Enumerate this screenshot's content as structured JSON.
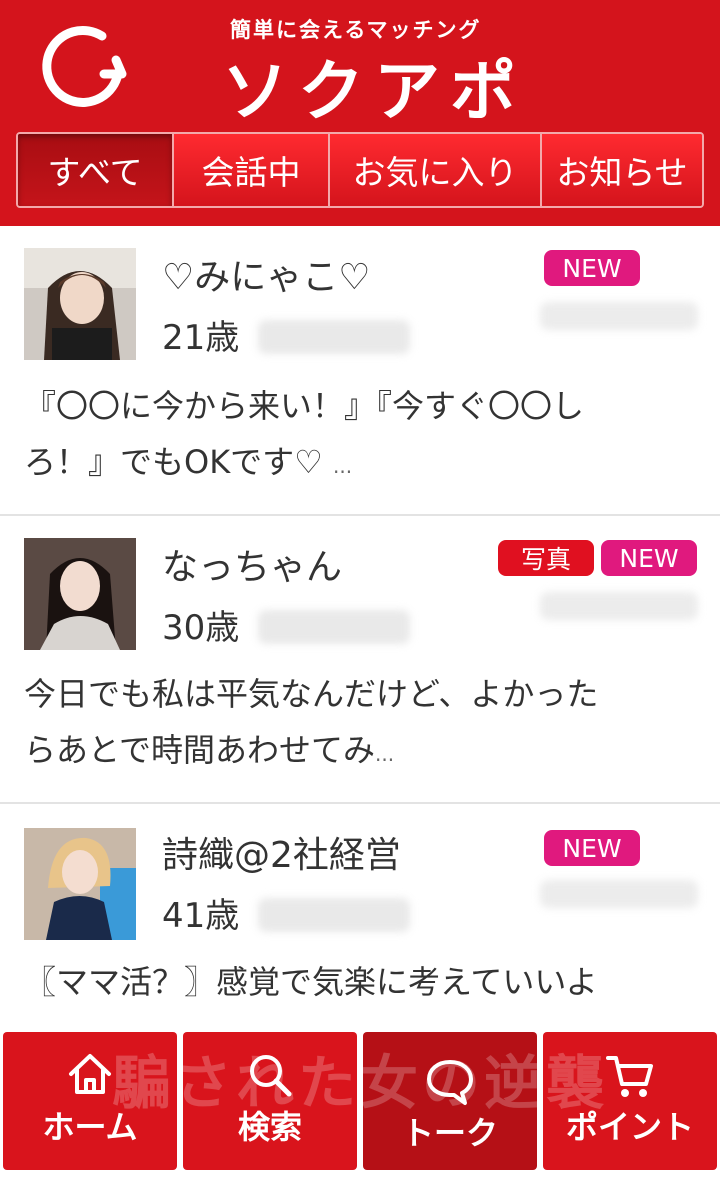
{
  "header": {
    "tagline": "簡単に会えるマッチング",
    "brand": "ソクアポ",
    "tabs": [
      {
        "label": "すべて",
        "active": true
      },
      {
        "label": "会話中",
        "active": false
      },
      {
        "label": "お気に入り",
        "active": false
      },
      {
        "label": "お知らせ",
        "active": false
      }
    ]
  },
  "messages": [
    {
      "name": "♡みにゃこ♡",
      "age": "21歳",
      "badges": [
        "NEW"
      ],
      "preview_line1": "『〇〇に今から来い！』『今すぐ〇〇し",
      "preview_line2": "ろ！』でもOKです♡",
      "ellipsis": "..."
    },
    {
      "name": "なっちゃん",
      "age": "30歳",
      "badges": [
        "写真",
        "NEW"
      ],
      "preview_line1": "今日でも私は平気なんだけど、よかった",
      "preview_line2": "らあとで時間あわせてみ",
      "ellipsis": "..."
    },
    {
      "name": "詩織@2社経営",
      "age": "41歳",
      "badges": [
        "NEW"
      ],
      "preview_line1": "〖ママ活？〗感覚で気楽に考えていいよ",
      "preview_line2": "",
      "ellipsis": ""
    }
  ],
  "bottom_nav": [
    {
      "label": "ホーム",
      "icon": "home-icon",
      "active": false
    },
    {
      "label": "検索",
      "icon": "search-icon",
      "active": false
    },
    {
      "label": "トーク",
      "icon": "chat-bubble-icon",
      "active": true
    },
    {
      "label": "ポイント",
      "icon": "cart-icon",
      "active": false
    }
  ],
  "watermark": "騙された女の逆襲",
  "colors": {
    "header_red": "#d4141c",
    "new_badge": "#e0197e",
    "photo_badge": "#e01020"
  }
}
